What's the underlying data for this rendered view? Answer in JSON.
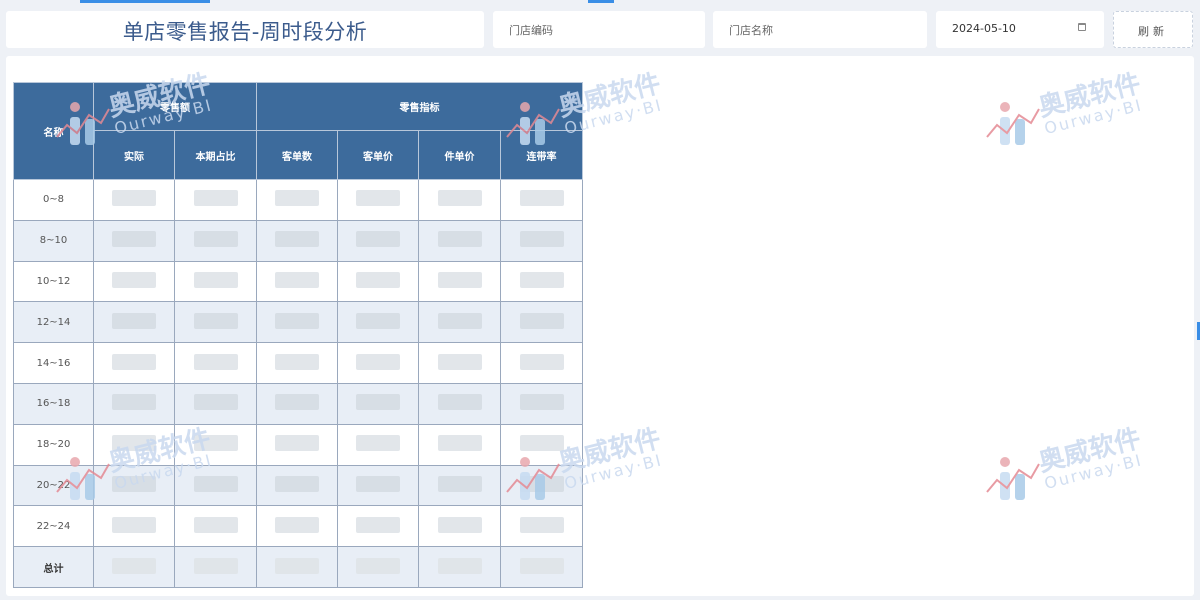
{
  "header": {
    "title": "单店零售报告-周时段分析",
    "store_code_placeholder": "门店编码",
    "store_name_placeholder": "门店名称",
    "date_value": "2024-05-10",
    "refresh_label": "刷新"
  },
  "table": {
    "name_header": "名称",
    "group_sales": "零售额",
    "group_metrics": "零售指标",
    "columns": [
      "实际",
      "本期占比",
      "客单数",
      "客单价",
      "件单价",
      "连带率"
    ],
    "rows": [
      "0~8",
      "8~10",
      "10~12",
      "12~14",
      "14~16",
      "16~18",
      "18~20",
      "20~22",
      "22~24"
    ],
    "total_label": "总计"
  },
  "watermark": {
    "cn": "奥威软件",
    "en": "Ourway·BI"
  }
}
